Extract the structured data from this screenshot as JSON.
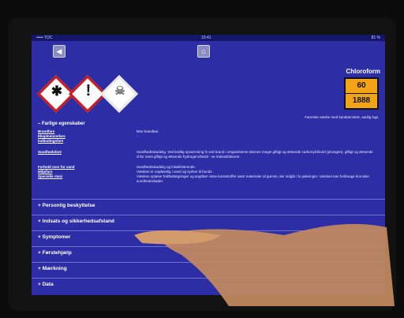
{
  "statusbar": {
    "carrier": "••••• TDC",
    "time": "19:41",
    "battery": "81 %"
  },
  "nav": {
    "back_label": "◀",
    "home_label": "⌂"
  },
  "hazard_icons": [
    "health-hazard-icon",
    "exclamation-icon",
    "skull-crossbones-icon"
  ],
  "substance": {
    "name": "Chloroform",
    "kemler": "60",
    "un": "1888",
    "description": "Farveløs væske med karakteristisk, sødlig lugt."
  },
  "section_open": "Farlige egenskaber",
  "properties": [
    {
      "label": "Brandfare",
      "value": "Ikke brandbar."
    },
    {
      "label": "Eksplosionsfare",
      "value": "-"
    },
    {
      "label": "Indåndingsfare",
      "value": ""
    },
    {
      "label": "Sundhedsfare",
      "value": "Sundhedsskadelig. Ved kraftig opvarmning fx ved brand i omgivelserne dannes meget giftigt og ætsende carbonylchlorid (phosgen), giftigt og ætsende chlor samt giftigt og ætsende hydrogenchlorid - se indsatsfaktorer."
    },
    {
      "label": "Forhold over for vand",
      "value": "Sundhedsskadelig og lokalirriterende."
    },
    {
      "label": "Miljøfare",
      "value": "Væsken er uopløselig i vand og synker til bunds."
    },
    {
      "label": "Specielle risici",
      "value": "Væsken opløser fedtbelægninger og angriber visse kunststoffer samt materialer af gummi, der indgår i fx pakninger. Væsken kan forårsage kroniske sundhedsskader."
    }
  ],
  "accordions": [
    "Personlig beskyttelse",
    "Indsats og sikkerhedsafstand",
    "Symptomer",
    "Førstehjælp",
    "Mærkning",
    "Data"
  ]
}
